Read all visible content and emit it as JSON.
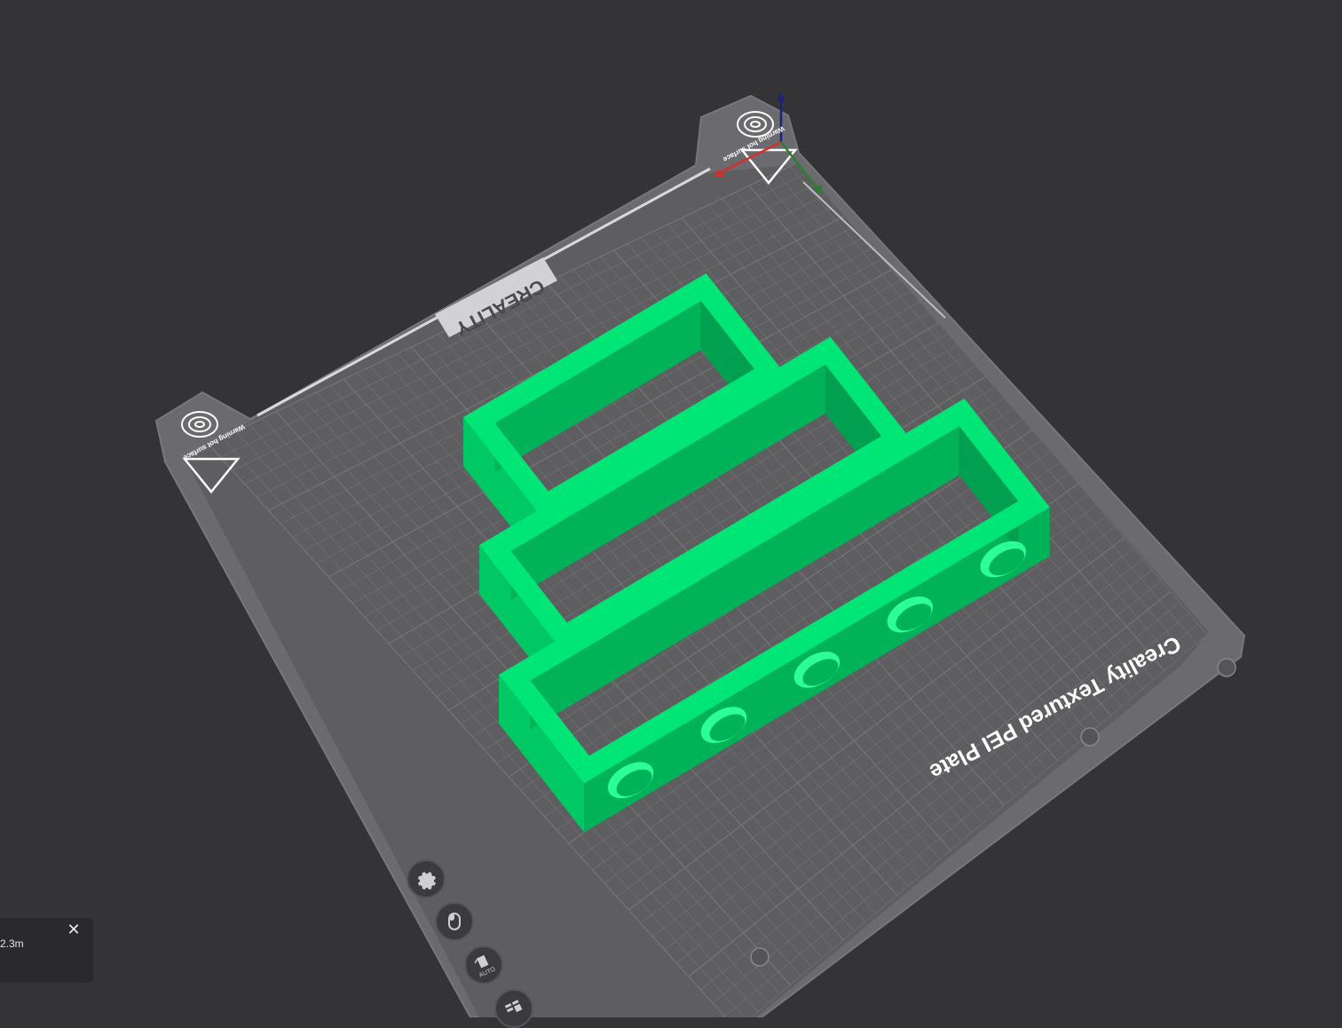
{
  "viewport": {
    "background": "#343437",
    "plate_fill": "#5e5e61",
    "plate_border": "#6c6c70",
    "grid_color": "#7a7a7e",
    "model_color": "#00e676",
    "model_dark": "#00b359"
  },
  "plate": {
    "brand_logo": "CREALITY",
    "plate_name": "Creality Textured PEI Plate",
    "warning_text": "Warning hot surface",
    "warning_icons": [
      "fingerprint-icon",
      "heat-warning-icon"
    ]
  },
  "axes": {
    "x_color": "#d32f2f",
    "y_color": "#2e7d32",
    "z_color": "#1a237e"
  },
  "side_toolbar": [
    {
      "name": "settings-button",
      "icon": "gear-icon"
    },
    {
      "name": "arrange-mode-button",
      "icon": "mouse-icon"
    },
    {
      "name": "auto-orient-button",
      "icon": "auto-orient-icon",
      "label": "AUTO"
    },
    {
      "name": "layout-button",
      "icon": "layout-icon"
    }
  ],
  "notification": {
    "text": "2.3m",
    "close_icon": "close-icon"
  }
}
